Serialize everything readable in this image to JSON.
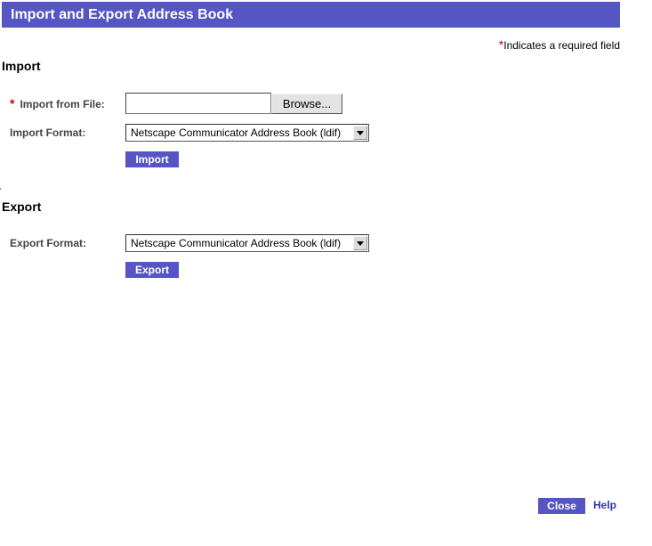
{
  "header": {
    "title": "Import and Export Address Book"
  },
  "required_note": {
    "star": "*",
    "text": "Indicates a required field"
  },
  "import": {
    "heading": "Import",
    "file_label_star": "*",
    "file_label": "Import from File:",
    "file_value": "",
    "browse_label": "Browse...",
    "format_label": "Import Format:",
    "format_selected": "Netscape Communicator Address Book (ldif)",
    "button_label": "Import"
  },
  "export": {
    "heading": "Export",
    "format_label": "Export Format:",
    "format_selected": "Netscape Communicator Address Book (ldif)",
    "button_label": "Export"
  },
  "footer": {
    "close_label": "Close",
    "help_label": "Help"
  },
  "colors": {
    "header_bg": "#5555c3",
    "button_bg": "#5555c3",
    "required_star": "#cc0000",
    "link": "#3333aa"
  }
}
